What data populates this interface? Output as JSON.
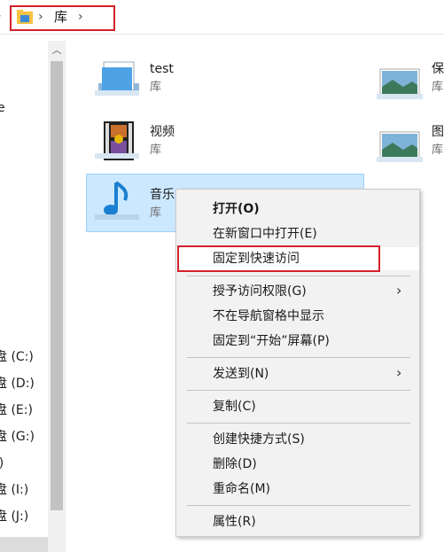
{
  "address_bar": {
    "path": [
      "库"
    ]
  },
  "nav": {
    "partial_label": "e",
    "drives": [
      "盘 (C:)",
      "盘 (D:)",
      "盘 (E:)",
      "盘 (G:)",
      ":)",
      "盘 (I:)",
      "盘 (J:)"
    ]
  },
  "libraries": [
    {
      "name": "test",
      "type": "库",
      "icon": "blank-library-icon"
    },
    {
      "name": "保",
      "type": "库",
      "icon": "pictures-library-icon"
    },
    {
      "name": "视频",
      "type": "库",
      "icon": "videos-library-icon"
    },
    {
      "name": "图",
      "type": "库",
      "icon": "pictures-library-icon"
    },
    {
      "name": "音乐",
      "type": "库",
      "icon": "music-library-icon"
    }
  ],
  "context_menu": {
    "items": [
      {
        "label": "打开(O)",
        "bold": true
      },
      {
        "label": "在新窗口中打开(E)"
      },
      {
        "label": "固定到快速访问",
        "highlighted": true
      },
      {
        "label": "授予访问权限(G)",
        "submenu": true
      },
      {
        "label": "不在导航窗格中显示"
      },
      {
        "label": "固定到“开始”屏幕(P)"
      },
      {
        "label": "发送到(N)",
        "submenu": true
      },
      {
        "label": "复制(C)"
      },
      {
        "label": "创建快捷方式(S)"
      },
      {
        "label": "删除(D)"
      },
      {
        "label": "重命名(M)"
      },
      {
        "label": "属性(R)"
      }
    ]
  },
  "colors": {
    "highlight_box": "#d3222a",
    "selection_bg": "#cce8ff",
    "menu_bg": "#f2f2f2"
  }
}
